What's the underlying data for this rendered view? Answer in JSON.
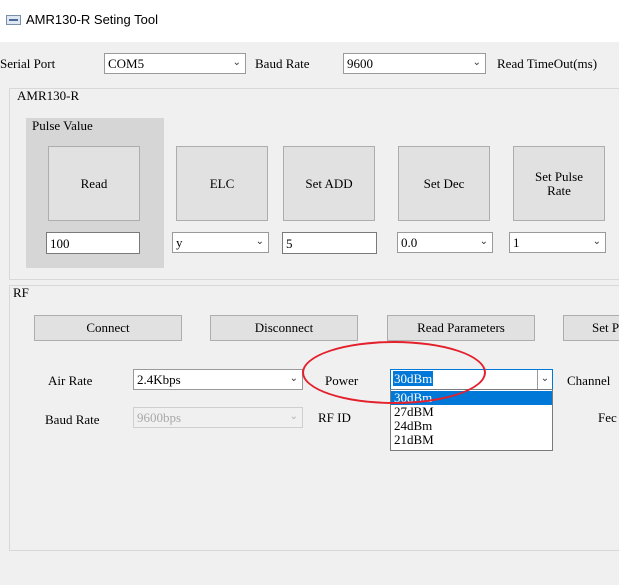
{
  "window": {
    "title": "AMR130-R  Seting Tool"
  },
  "top": {
    "serial_port_label": "Serial Port",
    "serial_port_value": "COM5",
    "baud_rate_label": "Baud Rate",
    "baud_rate_value": "9600",
    "read_timeout_label": "Read TimeOut(ms)"
  },
  "amr": {
    "group_title": "AMR130-R",
    "pulse_group_title": "Pulse Value",
    "buttons": [
      "Read",
      "ELC",
      "Set ADD",
      "Set Dec",
      "Set Pulse Rate"
    ],
    "pulse_value": "100",
    "elc_value": "y",
    "add_value": "5",
    "dec_value": "0.0",
    "rate_value": "1"
  },
  "rf": {
    "group_title": "RF",
    "connect_label": "Connect",
    "disconnect_label": "Disconnect",
    "read_params_label": "Read Parameters",
    "set_params_label": "Set Parameters",
    "air_rate_label": "Air Rate",
    "air_rate_value": "2.4Kbps",
    "power_label": "Power",
    "power_value": "30dBm",
    "power_options": [
      "30dBm",
      "27dBM",
      "24dBm",
      "21dBM"
    ],
    "channel_label": "Channel",
    "baud_rate_label": "Baud Rate",
    "baud_rate_value": "9600bps",
    "rf_id_label": "RF  ID",
    "fec_label": "Fec"
  },
  "colors": {
    "selection": "#0078d7",
    "annotation_ellipse": "#e3202c"
  }
}
